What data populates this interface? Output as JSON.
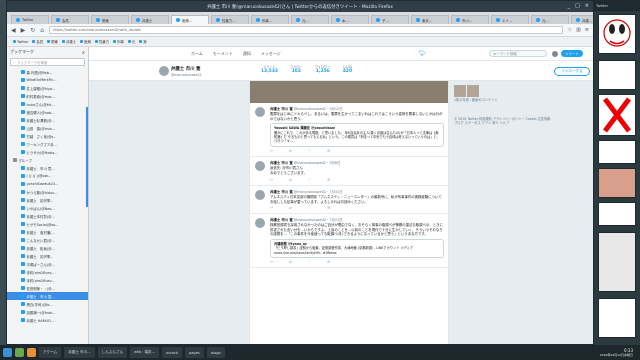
{
  "window": {
    "title": "弁護士 市川 寛(@marucokusaze42)さん | Twitterからの返信付きツイート - Mozilla Firefox",
    "controls": [
      "_",
      "□",
      "×"
    ]
  },
  "tabs": [
    {
      "label": "Twitter"
    },
    {
      "label": "会員"
    },
    {
      "label": "関東"
    },
    {
      "label": "弁護士"
    },
    {
      "label": "医療…",
      "active": true
    },
    {
      "label": "性暴力…"
    },
    {
      "label": "刑事…"
    },
    {
      "label": "元…"
    },
    {
      "label": "木…"
    },
    {
      "label": "子…"
    },
    {
      "label": "東京…"
    },
    {
      "label": "市川…"
    },
    {
      "label": "エイ…"
    },
    {
      "label": "元…"
    },
    {
      "label": "弁護…"
    },
    {
      "label": "第…"
    },
    {
      "label": "弁…"
    },
    {
      "label": "実…"
    }
  ],
  "navbar": {
    "url": "https://twitter.com/marucokusaze42/with_replies"
  },
  "bookmarks": [
    {
      "label": "Twitter"
    },
    {
      "label": "会員"
    },
    {
      "label": "関東"
    },
    {
      "label": "弁護士"
    },
    {
      "label": "医療"
    },
    {
      "label": "性暴力"
    },
    {
      "label": "刑事"
    },
    {
      "label": "元"
    },
    {
      "label": "実"
    }
  ],
  "sidebar": {
    "title": "ブックマーク",
    "search_placeholder": "ブックマークを検索",
    "items": [
      {
        "label": "森 玲語(@Rob...",
        "kind": "item"
      },
      {
        "label": "WhatOnMerkFin...",
        "kind": "item"
      },
      {
        "label": "井上康樹(@hiyo...",
        "kind": "item"
      },
      {
        "label": "町村泰貴(@mac...",
        "kind": "item"
      },
      {
        "label": "trukeさん(@trk...",
        "kind": "item"
      },
      {
        "label": "渡辺輝人(@nab...",
        "kind": "item"
      },
      {
        "label": "弁護士杉澤蒼(@...",
        "kind": "item"
      },
      {
        "label": "山田　善(@risin...",
        "kind": "item"
      },
      {
        "label": "打越　さく良(@s...",
        "kind": "item"
      },
      {
        "label": "ワーキングプア弁...",
        "kind": "item"
      },
      {
        "label": "ヒラサカ(@Hosts...",
        "kind": "item"
      },
      {
        "label": "グループ",
        "kind": "folder"
      },
      {
        "label": "弁護士　市川 寛...",
        "kind": "item"
      },
      {
        "label": "( )( )( )(@osk...",
        "kind": "item"
      },
      {
        "label": "yohchiSawkuk23...",
        "kind": "item"
      },
      {
        "label": "かつら藤(@hiduu...",
        "kind": "item"
      },
      {
        "label": "弁護士　初沢季...",
        "kind": "item"
      },
      {
        "label": "いやぱん(@Neo...",
        "kind": "item"
      },
      {
        "label": "弁護士本村彰(@...",
        "kind": "item"
      },
      {
        "label": "ヒサモSocial(@so...",
        "kind": "item"
      },
      {
        "label": "弁護士　奥村徹(...",
        "kind": "item"
      },
      {
        "label": "こんなせい君(@...",
        "kind": "item"
      },
      {
        "label": "弁護士　松坂(@...",
        "kind": "item"
      },
      {
        "label": "弁護士　初沢季...",
        "kind": "item"
      },
      {
        "label": "平塚ぱーさん(@...",
        "kind": "item"
      },
      {
        "label": "寺町(aim2fluev...",
        "kind": "item"
      },
      {
        "label": "寺町(aim2fluev...",
        "kind": "item"
      },
      {
        "label": "佐田明美・・(@...",
        "kind": "item"
      },
      {
        "label": "弁護士　市川 寛...",
        "kind": "item",
        "selected": true
      },
      {
        "label": "黒白(羊司)(@o...",
        "kind": "item"
      },
      {
        "label": "加藤潮一(@hrok...",
        "kind": "item"
      },
      {
        "label": "弁護士 HAMUO...",
        "kind": "item"
      }
    ]
  },
  "twitter": {
    "nav": [
      "ホーム",
      "モーメント",
      "通知",
      "メッセージ"
    ],
    "search_placeholder": "キーワード検索",
    "tweet_button": "ツイート",
    "profile": {
      "name": "弁護士 市川 寛",
      "handle": "@marucokusaze42",
      "stats": [
        {
          "label": "ツイート",
          "value": "13,533"
        },
        {
          "label": "フォロー",
          "value": "102"
        },
        {
          "label": "フォロワー",
          "value": "1,256"
        },
        {
          "label": "いいね",
          "value": "420"
        }
      ],
      "follow_button": "フォローする"
    },
    "tweets": [
      {
        "name": "弁護士 市川 寛",
        "handle": "@marucokusaze42",
        "date": "9月12日",
        "body": "冤罪をはじめにドキらべし。あるいは、冤罪を生かってこまいれはこれてはこういう姿勢を悪事しないとかは分がのではないかと思う。",
        "quote": {
          "author": "Yasushi SAWA 澤藤宏 @yasuchisaw",
          "text": "確かにこれで、これがある問題、と思いました。 年K自治弁の主人(集く弁護は住んもの)が「日本人って法律は《無知識》だ やるものと思ってもえるね」という。この委員は「刑法って中世でもう自体は考えないっていうのは」と、つきつ「々…"
        },
        "actions": [
          "↩",
          "⇄",
          "♡",
          "✉"
        ]
      },
      {
        "name": "弁護士 市川 寛",
        "handle": "@marucokusaze42",
        "date": "9月8日",
        "reply_to": "返信先: @市川寛さん",
        "body": "おめでとうございます。",
        "actions": [
          "↩",
          "⇄",
          "♡",
          "✉"
        ]
      },
      {
        "name": "弁護士 市川 寛",
        "handle": "@marucokusaze42",
        "date": "7月31日",
        "body": "アムネスティ日本支部の機関誌「アムネスティ・ニュースレター」の最新号に、私が刑事事件の実務経験についてお話しした記事が載っています。よろしければお読みください。",
        "actions": [
          "↩",
          "⇄",
          "♡",
          "✉"
        ]
      },
      {
        "name": "弁護士 市川 寛",
        "handle": "@marucokusaze42",
        "date": "7月21日",
        "body": "検察官調書も採用されなかったのはご自分が理由でなく、おそらく検事の取調べが警察の違法な取調べの、ときに供述された言い分を…いからですよ。上島のことを…以前のことを現代で十分に生かしていく、そういうそれなりの感想を…「この事件を今後誤っても取調べ(を)できるようになっているかと思う」というあな方です。",
        "quote": {
          "author": "弁護新聞 @tyano_ay",
          "text": "「ビラ押し調書」証拠から破棄、証拠調査作成、大津地裁 (京都新聞) - LINEアカウント メディア news.line.me/issue/lacltyk9Ir...#HNews"
        },
        "actions": [
          "↩",
          "⇄",
          "♡",
          "✉"
        ]
      }
    ],
    "right_column": {
      "media_label": "1枚の写真・動画のコンテンツ",
      "footer": "© 2018 Twitter 利用規約 プライバシーポリシー Cookie 広告情報 ブログ ステータス アプリ 求人 ヘルプ"
    }
  },
  "right_panel": {
    "header": "Twitter"
  },
  "taskbar": {
    "items": [
      "アクーム",
      "弁護士 市川...",
      "しんぶんさん",
      "a6b : 端末...",
      "octock",
      "pages",
      "alogo"
    ],
    "clock_time": "0:33",
    "clock_date": "2018年09月12日水曜日"
  }
}
